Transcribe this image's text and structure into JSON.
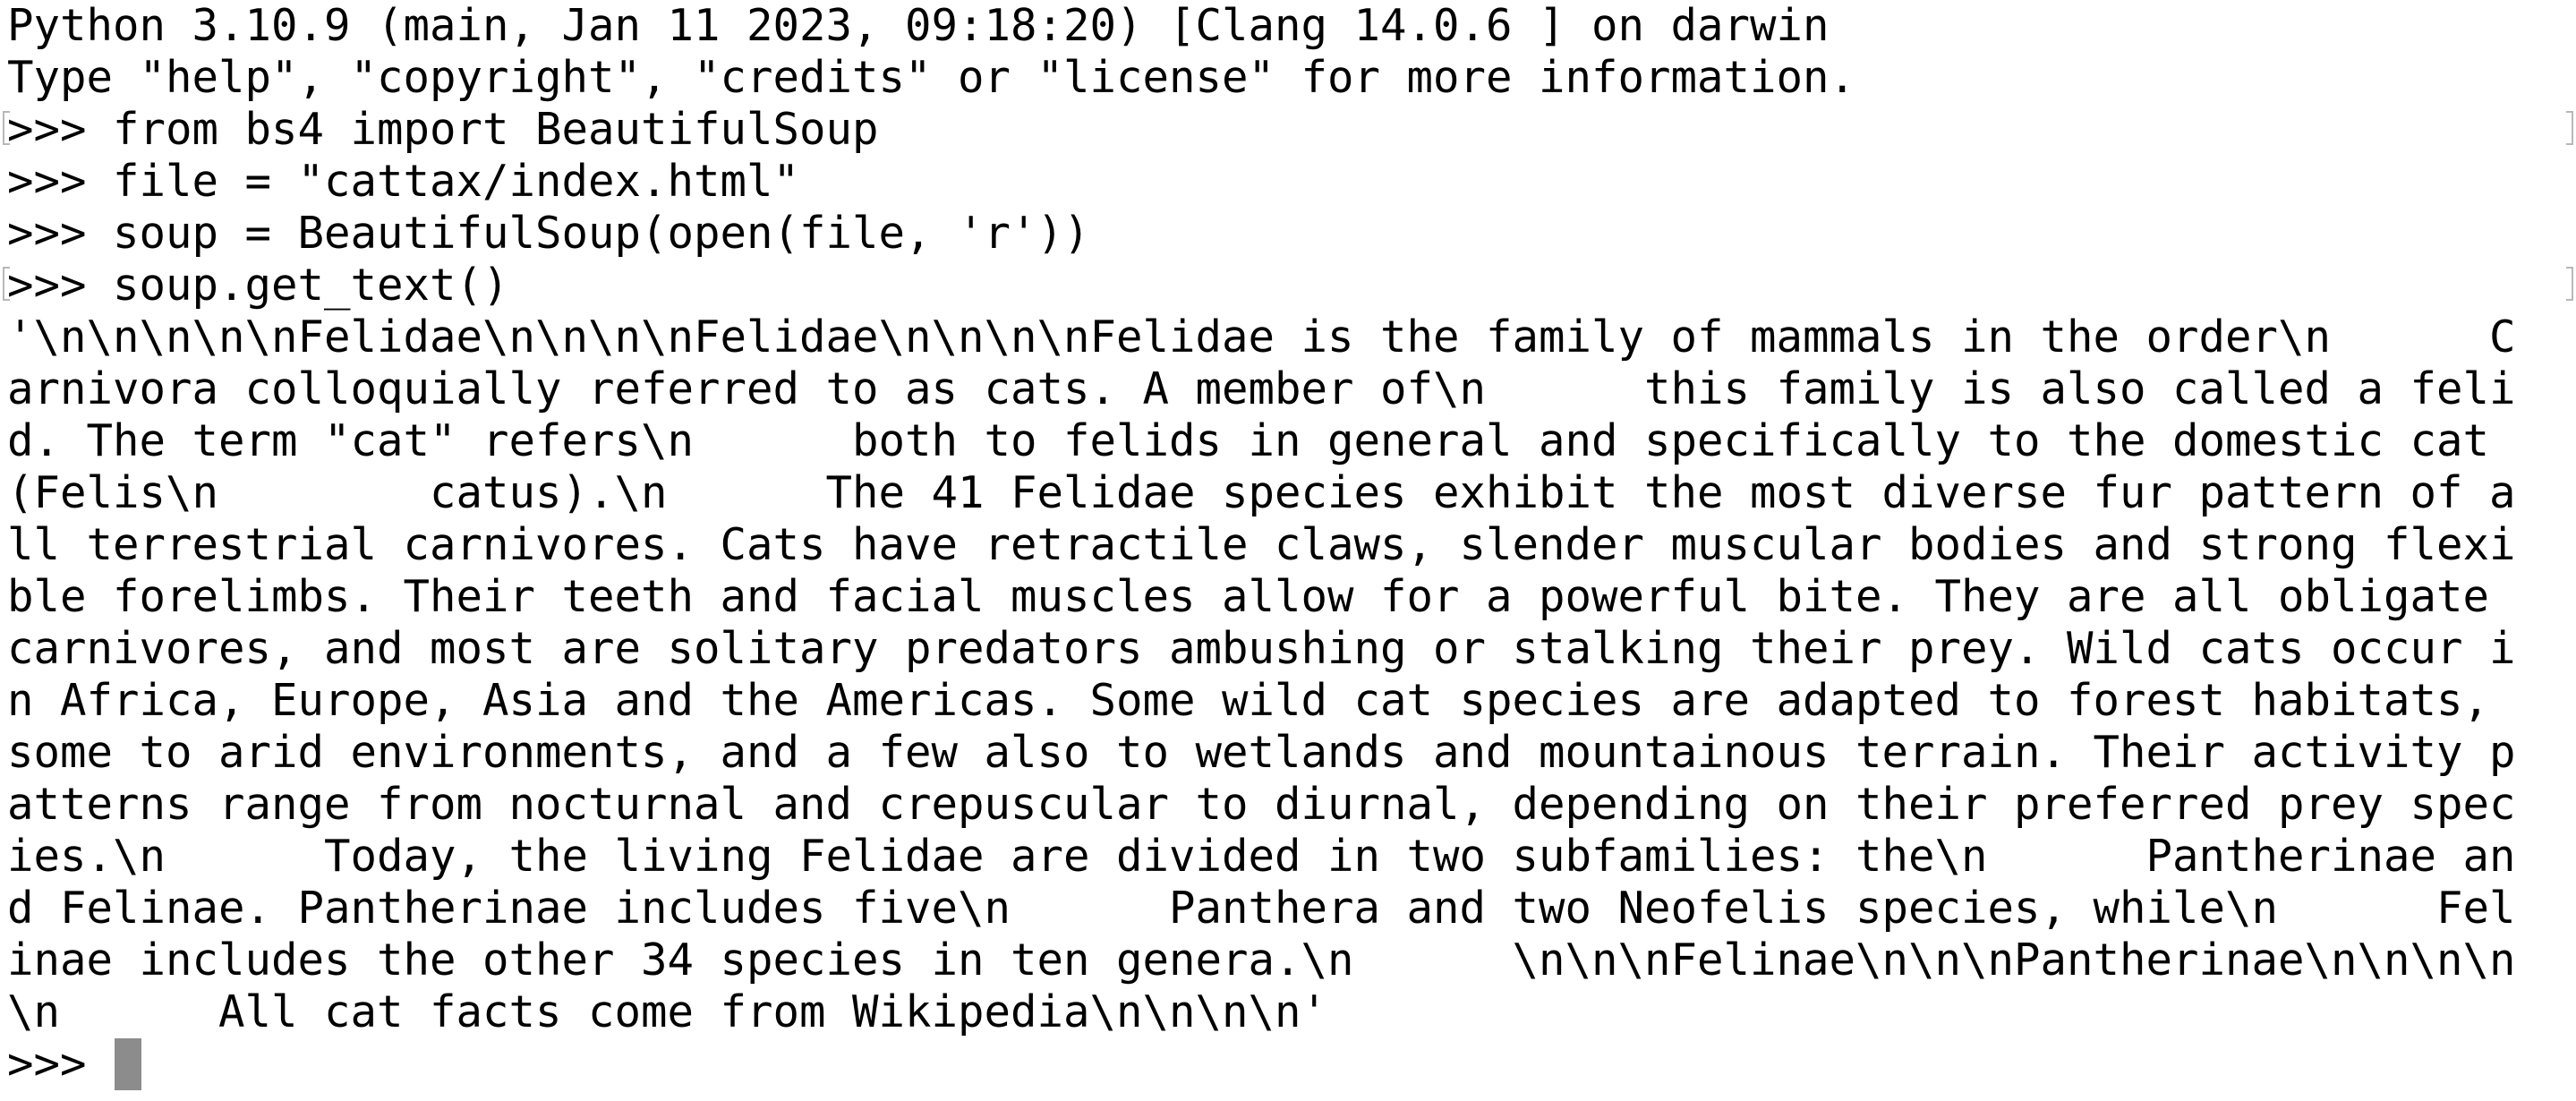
{
  "terminal": {
    "lines": [
      "Python 3.10.9 (main, Jan 11 2023, 09:18:20) [Clang 14.0.6 ] on darwin",
      "Type \"help\", \"copyright\", \"credits\" or \"license\" for more information.",
      ">>> from bs4 import BeautifulSoup",
      ">>> file = \"cattax/index.html\"",
      ">>> soup = BeautifulSoup(open(file, 'r'))",
      ">>> soup.get_text()",
      "'\\n\\n\\n\\n\\nFelidae\\n\\n\\n\\nFelidae\\n\\n\\n\\nFelidae is the family of mammals in the order\\n      C",
      "arnivora colloquially referred to as cats. A member of\\n      this family is also called a feli",
      "d. The term \"cat\" refers\\n      both to felids in general and specifically to the domestic cat",
      "(Felis\\n        catus).\\n      The 41 Felidae species exhibit the most diverse fur pattern of a",
      "ll terrestrial carnivores. Cats have retractile claws, slender muscular bodies and strong flexi",
      "ble forelimbs. Their teeth and facial muscles allow for a powerful bite. They are all obligate",
      "carnivores, and most are solitary predators ambushing or stalking their prey. Wild cats occur i",
      "n Africa, Europe, Asia and the Americas. Some wild cat species are adapted to forest habitats,",
      "some to arid environments, and a few also to wetlands and mountainous terrain. Their activity p",
      "atterns range from nocturnal and crepuscular to diurnal, depending on their preferred prey spec",
      "ies.\\n      Today, the living Felidae are divided in two subfamilies: the\\n      Pantherinae an",
      "d Felinae. Pantherinae includes five\\n      Panthera and two Neofelis species, while\\n      Fel",
      "inae includes the other 34 species in ten genera.\\n      \\n\\n\\nFelinae\\n\\n\\nPantherinae\\n\\n\\n\\n",
      "\\n      All cat facts come from Wikipedia\\n\\n\\n\\n'",
      ">>> "
    ]
  },
  "colors": {
    "background": "#ffffff",
    "text": "#000000",
    "cursor": "#8c8c8c",
    "marks": "#b8b8b8"
  }
}
